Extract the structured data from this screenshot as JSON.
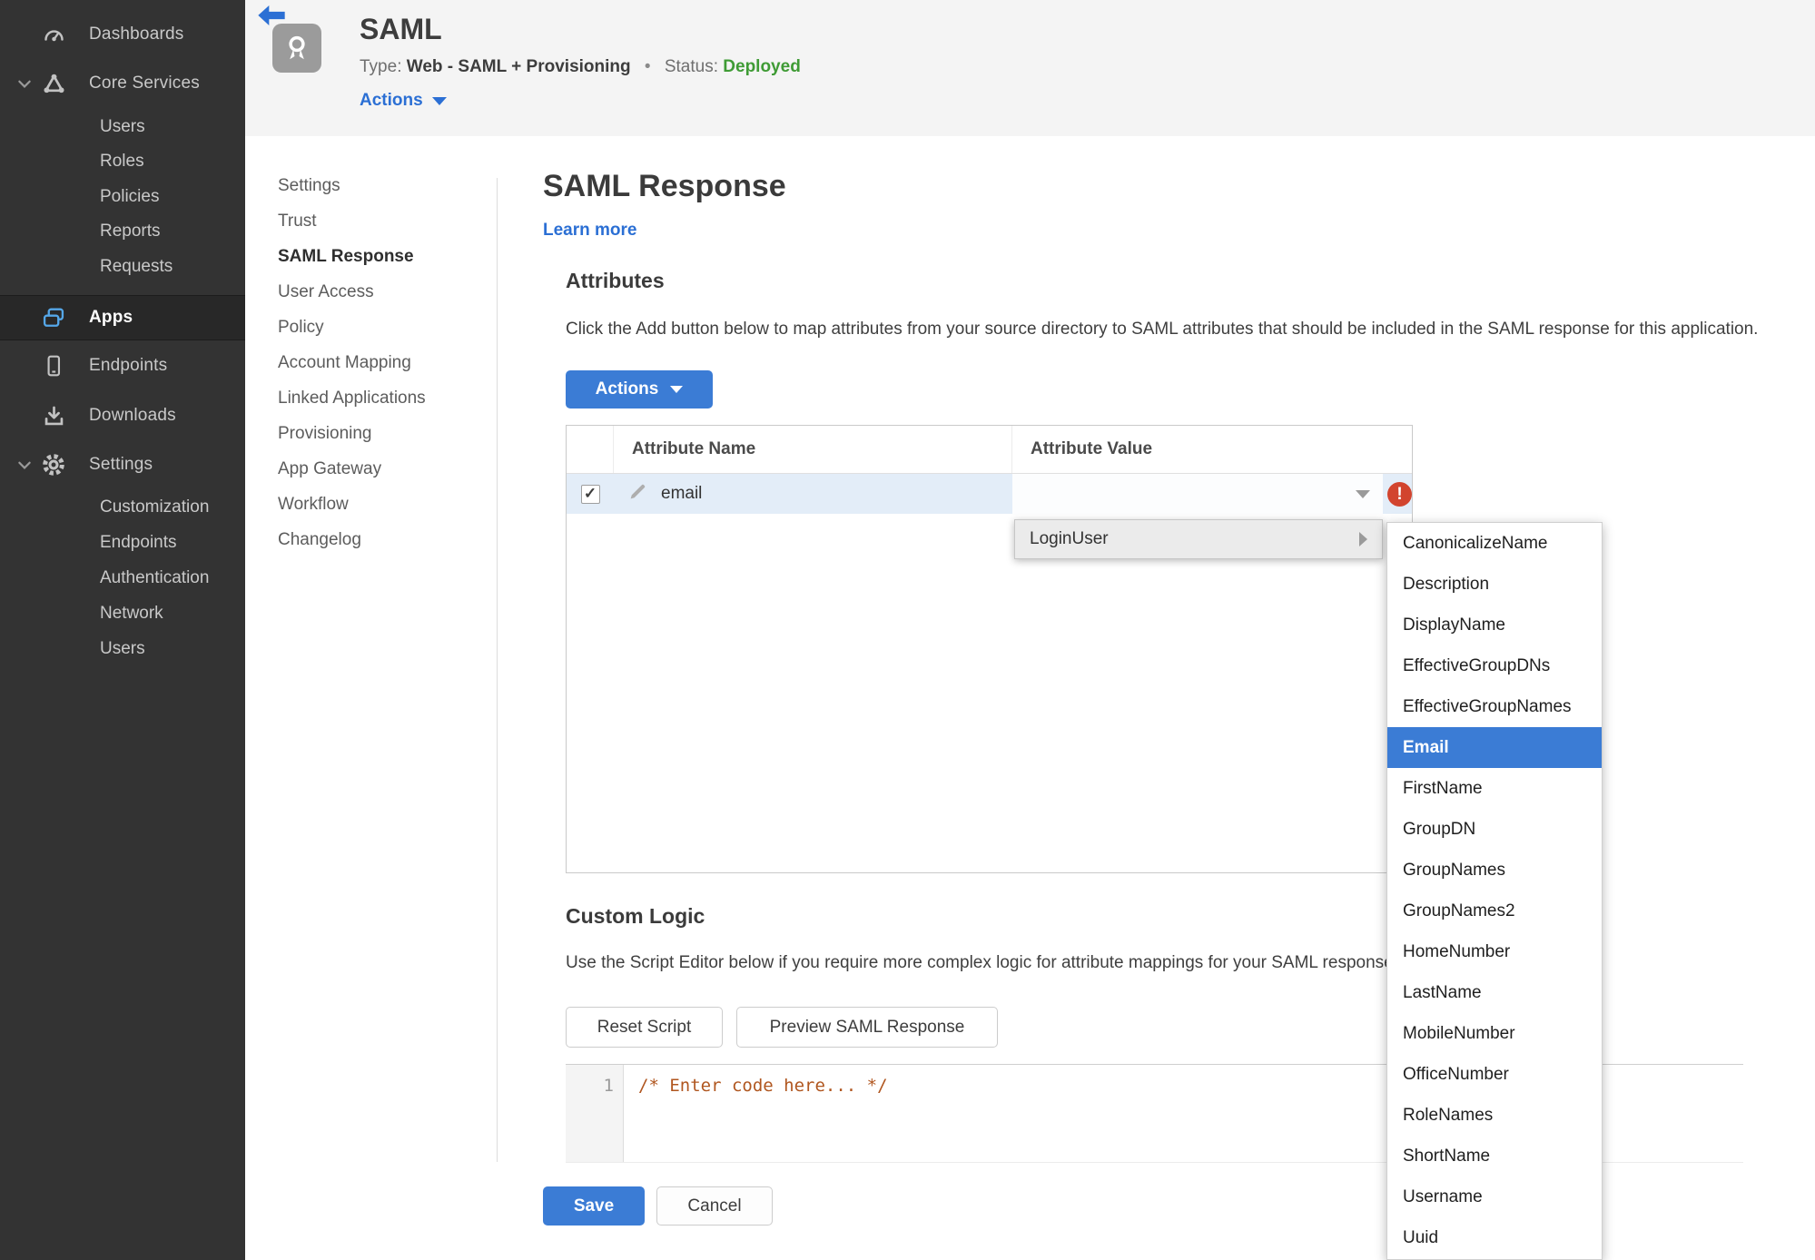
{
  "sidebar": {
    "items": [
      {
        "label": "Dashboards",
        "icon": "gauge-icon",
        "level": "top"
      },
      {
        "label": "Core Services",
        "icon": "core-services-icon",
        "level": "top",
        "expanded": true
      },
      {
        "label": "Users",
        "level": "sub"
      },
      {
        "label": "Roles",
        "level": "sub"
      },
      {
        "label": "Policies",
        "level": "sub"
      },
      {
        "label": "Reports",
        "level": "sub"
      },
      {
        "label": "Requests",
        "level": "sub"
      },
      {
        "label": "Apps",
        "icon": "apps-icon",
        "level": "top",
        "active": true
      },
      {
        "label": "Endpoints",
        "icon": "phone-icon",
        "level": "top"
      },
      {
        "label": "Downloads",
        "icon": "download-icon",
        "level": "top"
      },
      {
        "label": "Settings",
        "icon": "gear-icon",
        "level": "top",
        "expanded": true
      },
      {
        "label": "Customization",
        "level": "sub"
      },
      {
        "label": "Endpoints",
        "level": "sub"
      },
      {
        "label": "Authentication",
        "level": "sub"
      },
      {
        "label": "Network",
        "level": "sub"
      },
      {
        "label": "Users",
        "level": "sub"
      }
    ]
  },
  "header": {
    "app_title": "SAML",
    "type_label": "Type:",
    "type_value": "Web - SAML + Provisioning",
    "separator": "•",
    "status_label": "Status:",
    "status_value": "Deployed",
    "actions_label": "Actions"
  },
  "subnav": {
    "active": "SAML Response",
    "items": [
      "Settings",
      "Trust",
      "SAML Response",
      "User Access",
      "Policy",
      "Account Mapping",
      "Linked Applications",
      "Provisioning",
      "App Gateway",
      "Workflow",
      "Changelog"
    ]
  },
  "main": {
    "title": "SAML Response",
    "learn_more": "Learn more",
    "attributes": {
      "heading": "Attributes",
      "description": "Click the Add button below to map attributes from your source directory to SAML attributes that should be included in the SAML response for this application.",
      "actions_button": "Actions",
      "table": {
        "columns": [
          "Attribute Name",
          "Attribute Value"
        ],
        "row": {
          "name": "email",
          "checked": true
        }
      }
    },
    "value_menu": {
      "label": "LoginUser",
      "selected": "Email",
      "items": [
        "CanonicalizeName",
        "Description",
        "DisplayName",
        "EffectiveGroupDNs",
        "EffectiveGroupNames",
        "Email",
        "FirstName",
        "GroupDN",
        "GroupNames",
        "GroupNames2",
        "HomeNumber",
        "LastName",
        "MobileNumber",
        "OfficeNumber",
        "RoleNames",
        "ShortName",
        "Username",
        "Uuid"
      ]
    },
    "custom_logic": {
      "heading": "Custom Logic",
      "description": "Use the Script Editor below if you require more complex logic for attribute mappings for your SAML response.",
      "reset_button": "Reset Script",
      "preview_button": "Preview SAML Response",
      "editor": {
        "line_number": "1",
        "code": "/* Enter code here... */"
      }
    },
    "footer": {
      "save": "Save",
      "cancel": "Cancel"
    }
  },
  "icons": {
    "check": "✓",
    "exclamation": "!"
  },
  "colors": {
    "accent_blue": "#2b6fd4",
    "button_blue": "#3b7cd5",
    "status_green": "#3f9b35",
    "error_red": "#d2442e",
    "sidebar_bg": "#333333",
    "selected_row_blue": "#e3edf8"
  }
}
